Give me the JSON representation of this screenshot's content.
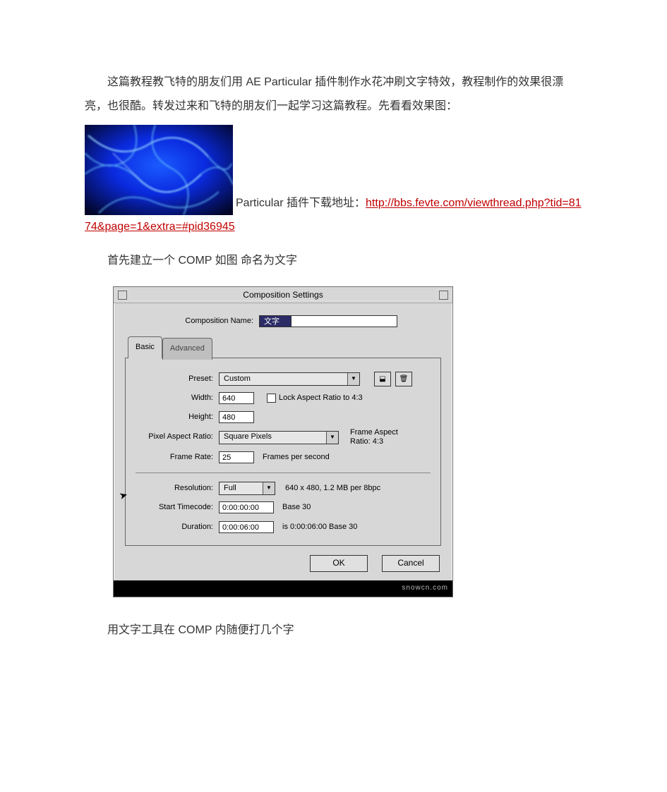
{
  "article": {
    "p1": "这篇教程教飞特的朋友们用 AE  Particular 插件制作水花冲刷文字特效，教程制作的效果很漂亮，也很酷。转发过来和飞特的朋友们一起学习这篇教程。先看看效果图：",
    "download_prefix": "Particular 插件下载地址：",
    "download_link": "http://bbs.fevte.com/viewthread.php?tid=8174&page=1&extra=#pid36945",
    "p2": "首先建立一个 COMP  如图  命名为文字",
    "p3": "用文字工具在 COMP 内随便打几个字"
  },
  "dialog": {
    "title": "Composition Settings",
    "comp_name_label": "Composition Name:",
    "comp_name_value": "文字",
    "tab_basic": "Basic",
    "tab_advanced": "Advanced",
    "preset_label": "Preset:",
    "preset_value": "Custom",
    "width_label": "Width:",
    "width_value": "640",
    "height_label": "Height:",
    "height_value": "480",
    "lock_ratio_label": "Lock Aspect Ratio to 4:3",
    "par_label": "Pixel Aspect Ratio:",
    "par_value": "Square Pixels",
    "frame_aspect_label": "Frame Aspect\nRatio: 4:3",
    "fps_label": "Frame Rate:",
    "fps_value": "25",
    "fps_suffix": "Frames per second",
    "res_label": "Resolution:",
    "res_value": "Full",
    "res_info": "640 x 480, 1.2 MB per 8bpc",
    "start_label": "Start Timecode:",
    "start_value": "0:00:00:00",
    "start_info": "Base 30",
    "dur_label": "Duration:",
    "dur_value": "0:00:06:00",
    "dur_info": "is 0:00:06:00  Base 30",
    "ok": "OK",
    "cancel": "Cancel",
    "watermark": "snowcn.com"
  }
}
